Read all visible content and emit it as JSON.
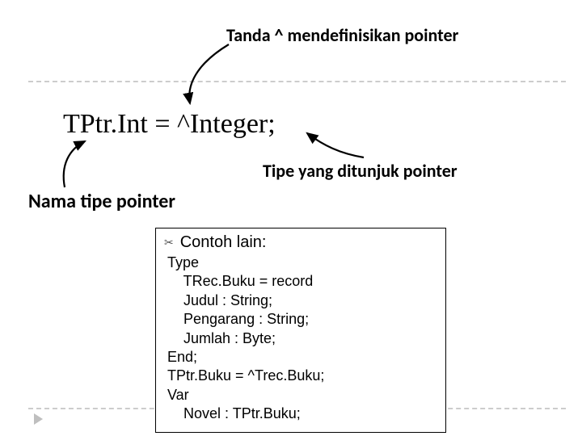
{
  "annotations": {
    "top": "Tanda ^ mendefinisikan pointer",
    "right": "Tipe yang ditunjuk pointer",
    "left": "Nama tipe pointer"
  },
  "code_line": "TPtr.Int = ^Integer;",
  "example": {
    "title": "Contoh lain:",
    "code": "Type\n    TRec.Buku = record\n    Judul : String;\n    Pengarang : String;\n    Jumlah : Byte;\nEnd;\nTPtr.Buku = ^Trec.Buku;\nVar\n    Novel : TPtr.Buku;"
  }
}
